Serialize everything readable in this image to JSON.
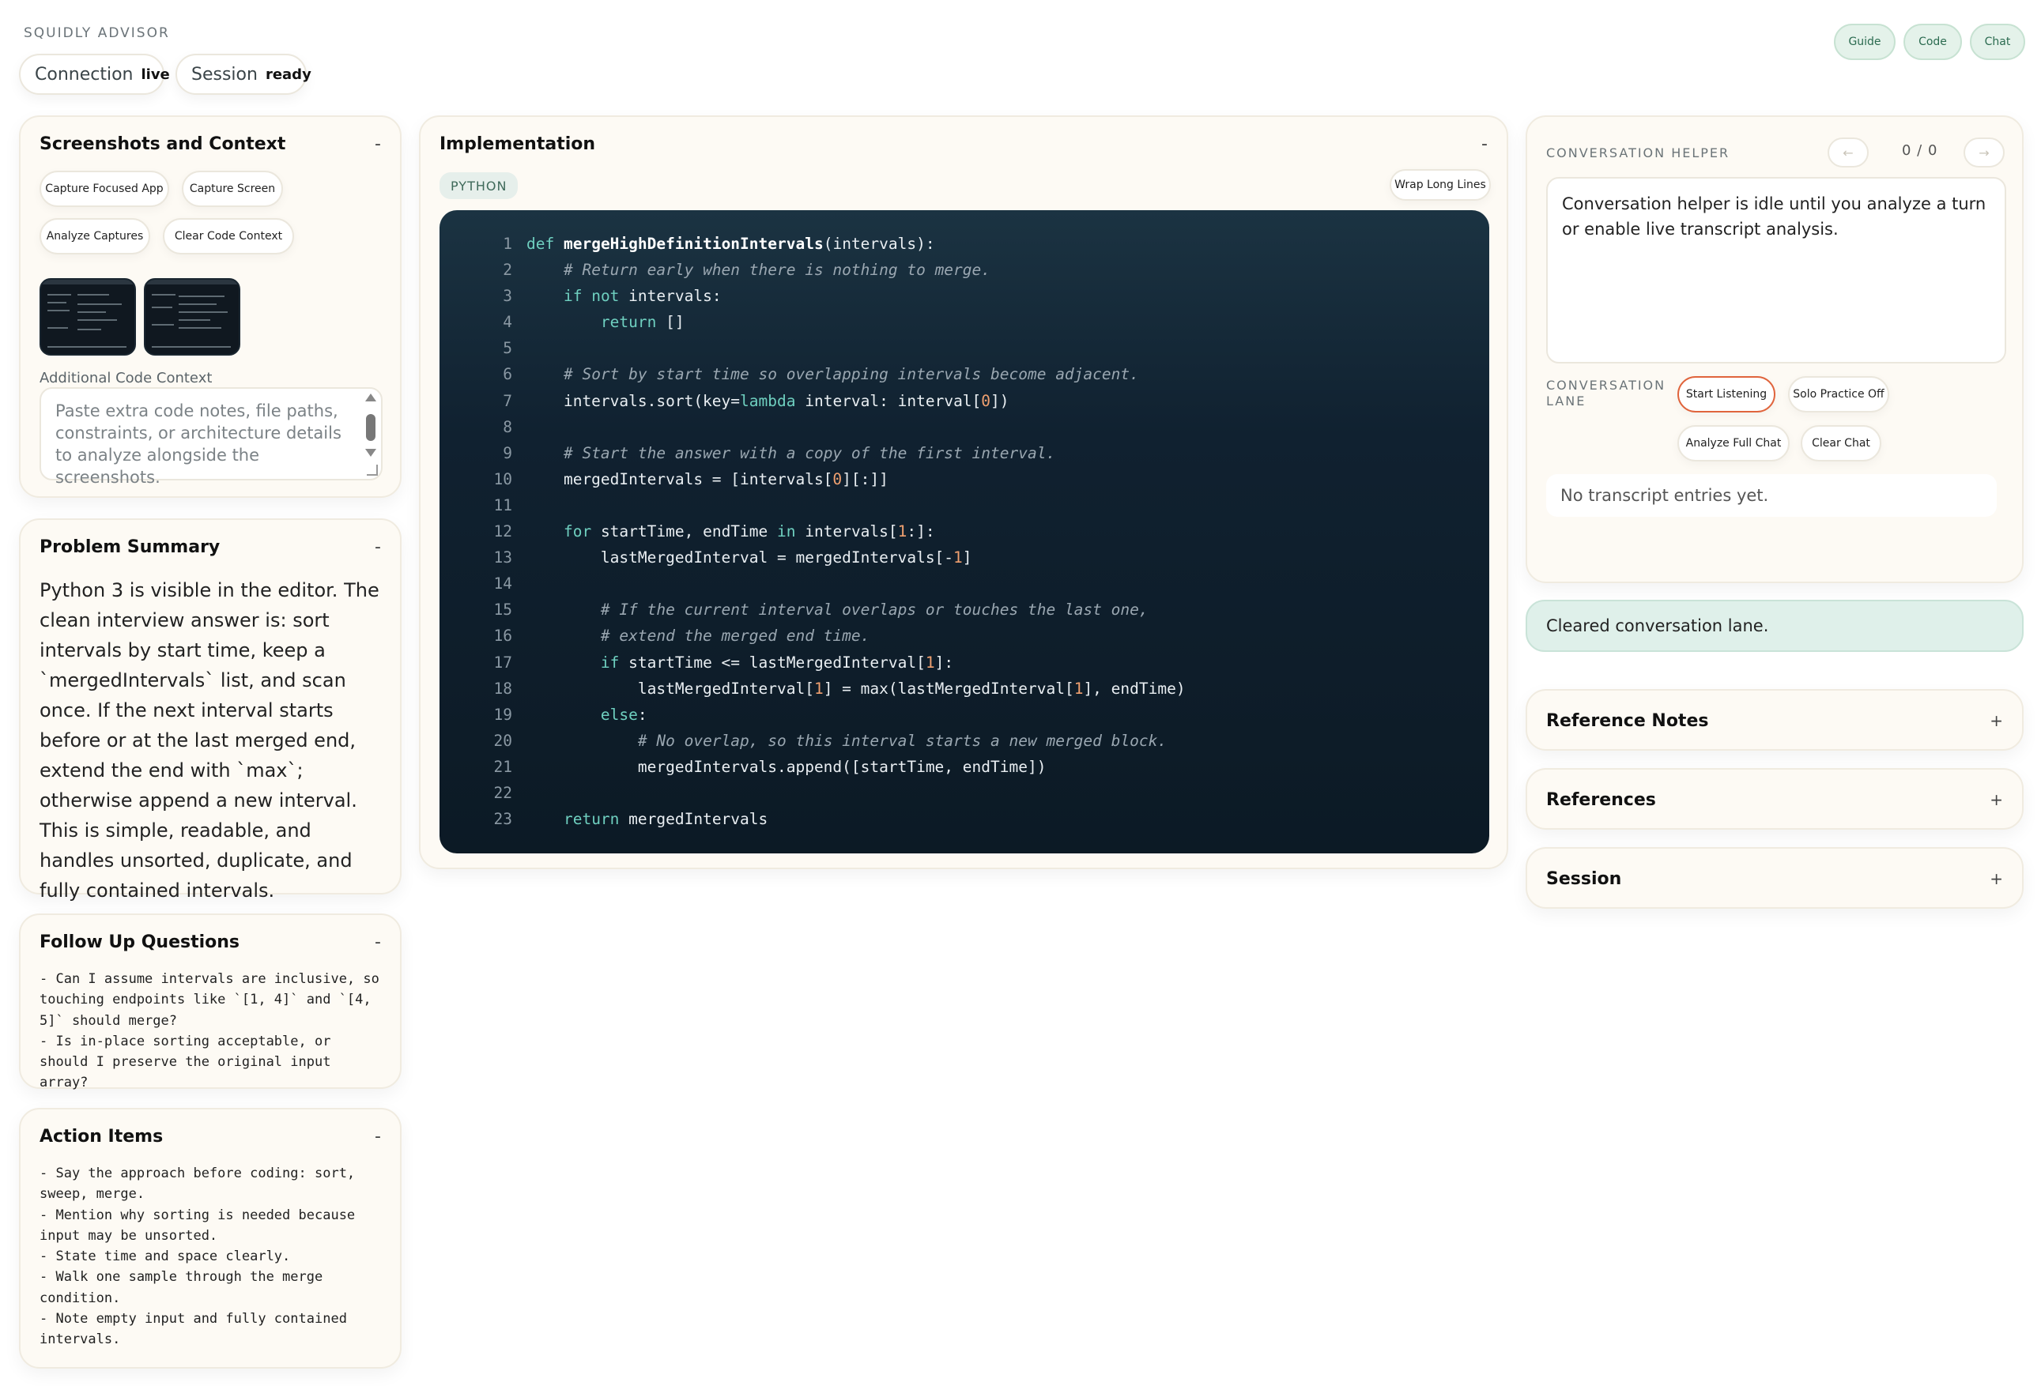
{
  "app": {
    "name": "SQUIDLY ADVISOR"
  },
  "status_pills": {
    "connection_label": "Connection",
    "connection_value": "live",
    "session_label": "Session",
    "session_value": "ready"
  },
  "top_nav": {
    "guide": "Guide",
    "code": "Code",
    "chat": "Chat"
  },
  "screenshots": {
    "title": "Screenshots and Context",
    "collapse": "-",
    "buttons": {
      "capture_focused": "Capture Focused App",
      "capture_screen": "Capture Screen",
      "analyze": "Analyze Captures",
      "clear_context": "Clear Code Context"
    },
    "context_label": "Additional Code Context",
    "context_placeholder": "Paste extra code notes, file paths, constraints, or architecture details to analyze alongside the screenshots."
  },
  "problem_summary": {
    "title": "Problem Summary",
    "collapse": "-",
    "text": "Python 3 is visible in the editor. The clean interview answer is: sort intervals by start time, keep a `mergedIntervals` list, and scan once. If the next interval starts before or at the last merged end, extend the end with `max`; otherwise append a new interval. This is simple, readable, and handles unsorted, duplicate, and fully contained intervals."
  },
  "follow_up": {
    "title": "Follow Up Questions",
    "collapse": "-",
    "text": "- Can I assume intervals are inclusive, so touching endpoints like `[1, 4]` and `[4, 5]` should merge?\n- Is in-place sorting acceptable, or should I preserve the original input array?"
  },
  "action_items": {
    "title": "Action Items",
    "collapse": "-",
    "text": "- Say the approach before coding: sort, sweep, merge.\n- Mention why sorting is needed because input may be unsorted.\n- State time and space clearly.\n- Walk one sample through the merge condition.\n- Note empty input and fully contained intervals."
  },
  "implementation": {
    "title": "Implementation",
    "collapse": "-",
    "language": "PYTHON",
    "wrap_button": "Wrap Long Lines",
    "code_lines": [
      "def mergeHighDefinitionIntervals(intervals):",
      "    # Return early when there is nothing to merge.",
      "    if not intervals:",
      "        return []",
      "",
      "    # Sort by start time so overlapping intervals become adjacent.",
      "    intervals.sort(key=lambda interval: interval[0])",
      "",
      "    # Start the answer with a copy of the first interval.",
      "    mergedIntervals = [intervals[0][:]]",
      "",
      "    for startTime, endTime in intervals[1:]:",
      "        lastMergedInterval = mergedIntervals[-1]",
      "",
      "        # If the current interval overlaps or touches the last one,",
      "        # extend the merged end time.",
      "        if startTime <= lastMergedInterval[1]:",
      "            lastMergedInterval[1] = max(lastMergedInterval[1], endTime)",
      "        else:",
      "            # No overlap, so this interval starts a new merged block.",
      "            mergedIntervals.append([startTime, endTime])",
      "",
      "    return mergedIntervals"
    ]
  },
  "conversation_helper": {
    "title": "CONVERSATION HELPER",
    "prev": "←",
    "counter": "0 / 0",
    "next": "→",
    "text": "Conversation helper is idle until you analyze a turn or enable live transcript analysis.",
    "lane_label": "CONVERSATION LANE",
    "buttons": {
      "start_listening": "Start Listening",
      "solo_practice": "Solo Practice Off",
      "analyze_full_chat": "Analyze Full Chat",
      "clear_chat": "Clear Chat"
    },
    "transcript_empty": "No transcript entries yet."
  },
  "status_message": "Cleared conversation lane.",
  "accordions": {
    "reference_notes": "Reference Notes",
    "references": "References",
    "session": "Session",
    "expand": "+"
  },
  "colors": {
    "accent_green": "#2b6b50",
    "code_bg": "#0c1a25",
    "start_listening_border": "#e0643c"
  }
}
